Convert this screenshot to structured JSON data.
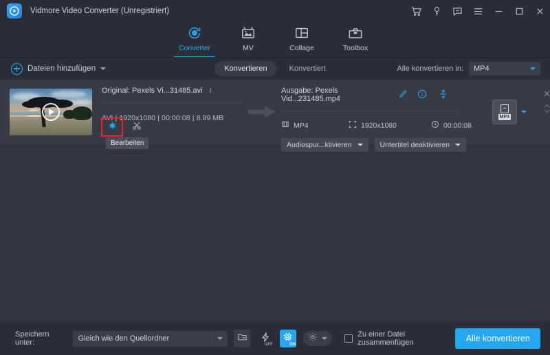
{
  "window": {
    "title": "Vidmore Video Converter (Unregistriert)",
    "logo_icon": "video-camera-icon",
    "controls": [
      {
        "name": "cart-icon",
        "glyph": "cart"
      },
      {
        "name": "key-icon",
        "glyph": "key"
      },
      {
        "name": "feedback-icon",
        "glyph": "chat"
      },
      {
        "name": "menu-icon",
        "glyph": "hamburger"
      },
      {
        "name": "minimize-button",
        "glyph": "minimize"
      },
      {
        "name": "maximize-button",
        "glyph": "maximize"
      },
      {
        "name": "close-button",
        "glyph": "close"
      }
    ]
  },
  "nav": {
    "active": "Converter",
    "tabs": [
      {
        "label": "Converter",
        "icon": "converter-icon"
      },
      {
        "label": "MV",
        "icon": "mv-icon"
      },
      {
        "label": "Collage",
        "icon": "collage-icon"
      },
      {
        "label": "Toolbox",
        "icon": "toolbox-icon"
      }
    ]
  },
  "actionbar": {
    "add_files_label": "Dateien hinzufügen",
    "tab_converting": "Konvertieren",
    "tab_converted": "Konvertiert",
    "convert_all_label": "Alle konvertieren in:",
    "convert_all_value": "MP4"
  },
  "file_row": {
    "source": {
      "title": "Original: Pexels Vi...31485.avi",
      "meta": "AVI | 1920x1080 | 00:00:08 | 8.99 MB",
      "format": "AVI",
      "resolution": "1920x1080",
      "duration": "00:00:08",
      "size": "8.99 MB",
      "edit_tooltip": "Bearbeiten",
      "edit_icon": "magic-wand-icon",
      "trim_icon": "scissors-icon",
      "thumbnail_alt": "beach-sunset-video-thumbnail"
    },
    "output": {
      "title": "Ausgabe: Pexels Vid...231485.mp4",
      "format": "MP4",
      "resolution": "1920x1080",
      "duration": "00:00:08",
      "audio_track": "Audiospur...ktivieren",
      "subtitle": "Untertitel deaktivieren",
      "badge_label": "MP4"
    }
  },
  "bottombar": {
    "save_to_label": "Speichern unter:",
    "save_to_value": "Gleich wie den Quellordner",
    "folder_icon": "folder-icon",
    "lightning_label": "OFF",
    "gpu_label": "ON",
    "merge_label": "Zu einer Datei zusammenfügen",
    "convert_button": "Alle konvertieren"
  },
  "colors": {
    "accent": "#23a7f2",
    "highlight": "#e8262a",
    "window_bg": "#2b2e39",
    "list_bg": "#32353f",
    "row_bg": "#383b45"
  }
}
